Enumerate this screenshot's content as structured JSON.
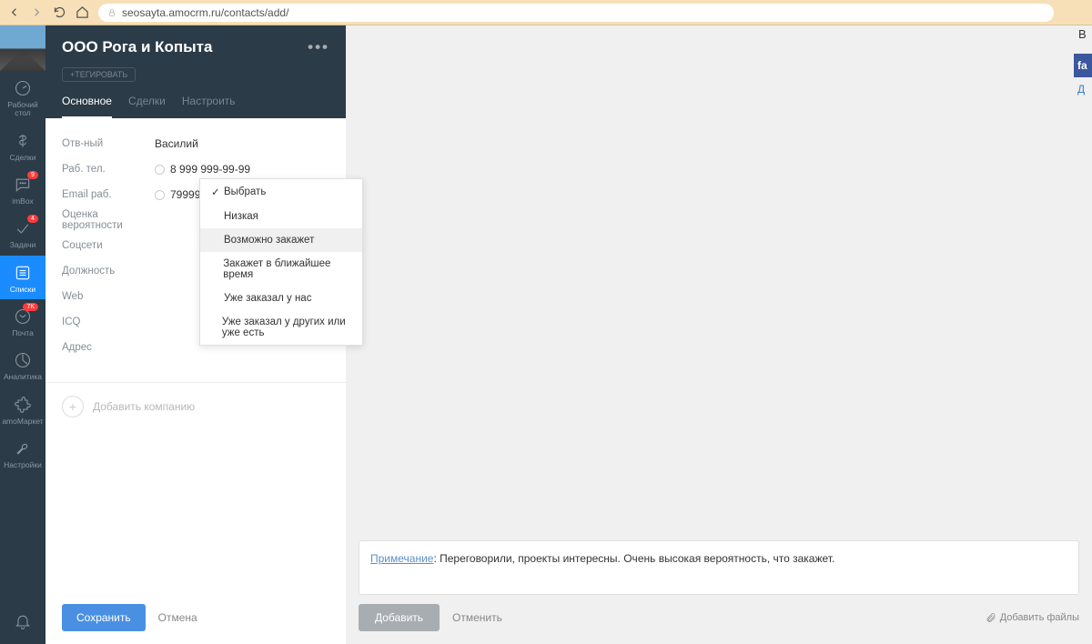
{
  "browser": {
    "url": "seosayta.amocrm.ru/contacts/add/"
  },
  "sidebar": {
    "items": [
      {
        "label": "Рабочий\nстол"
      },
      {
        "label": "Сделки"
      },
      {
        "label": "imBox",
        "badge": "9"
      },
      {
        "label": "Задачи",
        "badge": "4"
      },
      {
        "label": "Списки"
      },
      {
        "label": "Почта",
        "badge": "7K"
      },
      {
        "label": "Аналитика"
      },
      {
        "label": "amoМаркет"
      },
      {
        "label": "Настройки"
      }
    ]
  },
  "panel": {
    "title": "ООО Рога и Копыта",
    "tag": "+ТЕГИРОВАТЬ",
    "tabs": [
      "Основное",
      "Сделки",
      "Настроить"
    ],
    "fields": {
      "resp": {
        "label": "Отв-ный",
        "value": "Василий"
      },
      "phone": {
        "label": "Раб. тел.",
        "value": "8 999 999-99-99"
      },
      "email": {
        "label": "Email раб.",
        "value": "79999999999@yandex.ru"
      },
      "prob": {
        "label": "Оценка вероятности"
      },
      "soc": {
        "label": "Соцсети"
      },
      "pos": {
        "label": "Должность"
      },
      "web": {
        "label": "Web"
      },
      "icq": {
        "label": "ICQ"
      },
      "addr": {
        "label": "Адрес"
      }
    },
    "dropdown": [
      "Выбрать",
      "Низкая",
      "Возможно закажет",
      "Закажет в ближайшее время",
      "Уже заказал у нас",
      "Уже заказал у других или уже есть"
    ],
    "addCompany": "Добавить компанию",
    "save": "Сохранить",
    "cancel": "Отмена"
  },
  "note": {
    "label": "Примечание",
    "text": ": Переговорили, проекты интересны. Очень высокая вероятность, что закажет."
  },
  "actions": {
    "add": "Добавить",
    "cancel": "Отменить",
    "attach": "Добавить файлы"
  },
  "rightStrip": {
    "v": "В",
    "fb": "fa",
    "do": "Д"
  }
}
